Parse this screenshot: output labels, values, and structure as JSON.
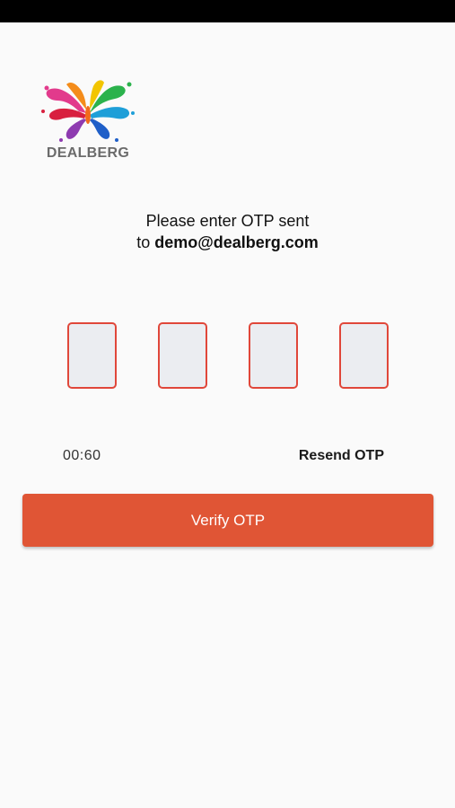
{
  "brand": {
    "logo_text": "DEALBERG"
  },
  "prompt": {
    "line1": "Please enter OTP sent",
    "line2_prefix": "to ",
    "email": "demo@dealberg.com"
  },
  "otp": {
    "digits": [
      "",
      "",
      "",
      ""
    ]
  },
  "timer": {
    "value": "00:60"
  },
  "actions": {
    "resend_label": "Resend OTP",
    "verify_label": "Verify OTP"
  },
  "colors": {
    "accent": "#e05535",
    "otp_border": "#e0473a",
    "otp_fill": "#ebedf1"
  }
}
